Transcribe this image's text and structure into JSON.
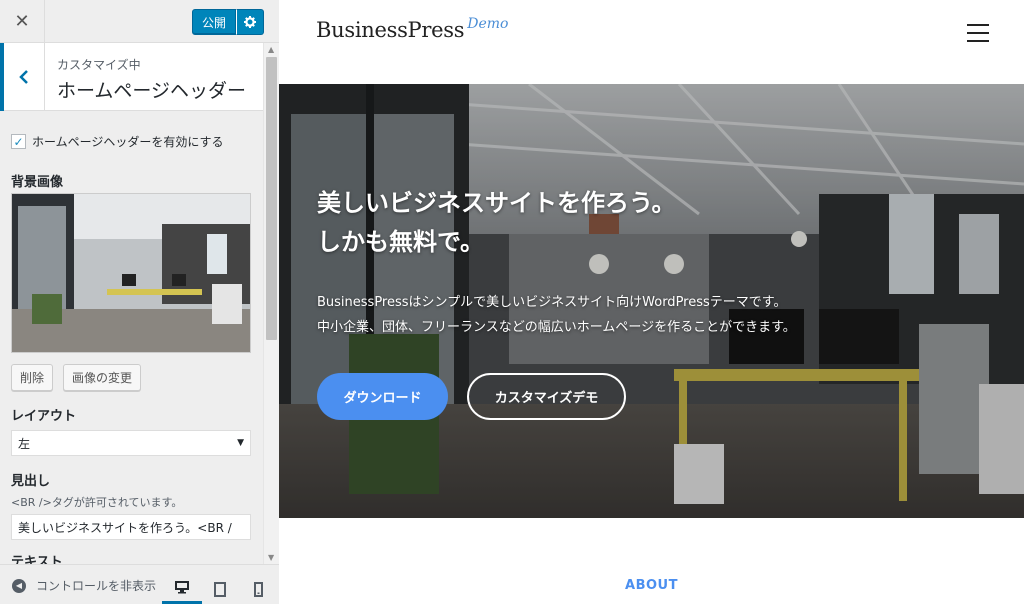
{
  "topbar": {
    "close_icon": "close-icon",
    "publish_label": "公開",
    "settings_icon": "gear-icon"
  },
  "section": {
    "breadcrumb": "カスタマイズ中",
    "title": "ホームページヘッダー"
  },
  "controls": {
    "enable_header_label": "ホームページヘッダーを有効にする",
    "enable_header_checked": true,
    "bg_image_label": "背景画像",
    "remove_button": "削除",
    "change_image_button": "画像の変更",
    "layout_label": "レイアウト",
    "layout_value": "左",
    "heading_label": "見出し",
    "heading_desc": "<BR />タグが許可されています。",
    "heading_value": "美しいビジネスサイトを作ろう。<BR /",
    "text_label": "テキスト"
  },
  "footer": {
    "hide_controls_label": "コントロールを非表示",
    "devices": [
      "desktop-icon",
      "tablet-icon",
      "mobile-icon"
    ],
    "active_device": "desktop"
  },
  "site": {
    "logo_main": "BusinessPress",
    "logo_demo": "Demo",
    "hero_title_line1": "美しいビジネスサイトを作ろう。",
    "hero_title_line2": "しかも無料で。",
    "hero_text_line1": "BusinessPressはシンプルで美しいビジネスサイト向けWordPressテーマです。",
    "hero_text_line2": "中小企業、団体、フリーランスなどの幅広いホームページを作ることができます。",
    "download_button": "ダウンロード",
    "customize_demo_button": "カスタマイズデモ",
    "about_label": "ABOUT"
  },
  "colors": {
    "wp_blue": "#0085ba",
    "accent_blue": "#4b8ff0",
    "sidebar_bg": "#eeeeee"
  }
}
